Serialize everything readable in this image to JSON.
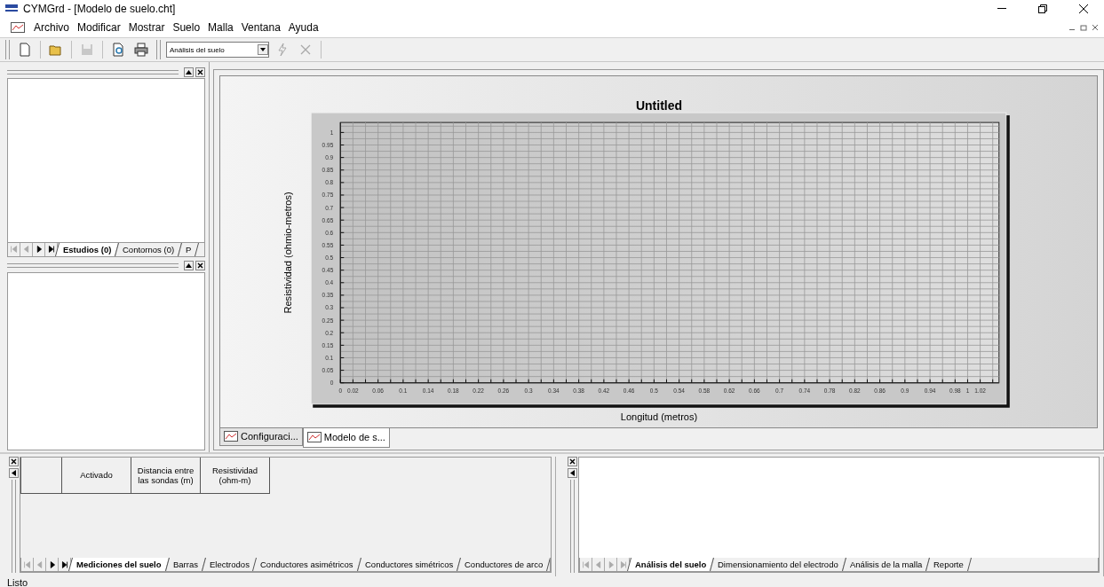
{
  "window": {
    "title": "CYMGrd - [Modelo de suelo.cht]"
  },
  "menu": [
    "Archivo",
    "Modificar",
    "Mostrar",
    "Suelo",
    "Malla",
    "Ventana",
    "Ayuda"
  ],
  "toolbar": {
    "buttons": [
      {
        "kind": "new",
        "disabled": false
      },
      {
        "kind": "open",
        "disabled": false
      },
      {
        "kind": "save",
        "disabled": true
      },
      {
        "kind": "preview",
        "disabled": false
      },
      {
        "kind": "print",
        "disabled": false
      }
    ],
    "study_select": {
      "value": "Análisis del suelo"
    },
    "actions": [
      {
        "kind": "run",
        "disabled": true
      },
      {
        "kind": "stop",
        "disabled": true
      }
    ]
  },
  "left_top_panel": {
    "nav_enabled": true,
    "tabs": [
      {
        "label": "Estudios (0)",
        "selected": true
      },
      {
        "label": "Contornos (0)",
        "selected": false
      },
      {
        "label": "P",
        "selected": false
      }
    ]
  },
  "chart_window": {
    "chart_data": {
      "type": "line",
      "grid": true,
      "title": "Untitled",
      "xlabel": "Longitud (metros)",
      "ylabel": "Resistividad (ohmio-metros)",
      "xlim": [
        0,
        1.05
      ],
      "ylim": [
        0,
        1.04
      ],
      "xticks": [
        0,
        0.02,
        0.06,
        0.1,
        0.14,
        0.18,
        0.22,
        0.26,
        0.3,
        0.34,
        0.38,
        0.42,
        0.46,
        0.5,
        0.54,
        0.58,
        0.62,
        0.66,
        0.7,
        0.74,
        0.78,
        0.82,
        0.86,
        0.9,
        0.94,
        0.98,
        1,
        1.02
      ],
      "yticks": [
        0,
        0.05,
        0.1,
        0.15,
        0.2,
        0.25,
        0.3,
        0.35,
        0.4,
        0.45,
        0.5,
        0.55,
        0.6,
        0.65,
        0.7,
        0.75,
        0.8,
        0.85,
        0.9,
        0.95,
        1
      ]
    },
    "tabs": [
      {
        "label": "Configuraci...",
        "selected": false
      },
      {
        "label": "Modelo de s...",
        "selected": true
      }
    ]
  },
  "measurements_panel": {
    "columns": [
      "",
      "Activado",
      "Distancia entre las sondas (m)",
      "Resistividad (ohm-m)"
    ],
    "nav_enabled": true,
    "tabs": [
      {
        "label": "Mediciones del suelo",
        "selected": true
      },
      {
        "label": "Barras",
        "selected": false
      },
      {
        "label": "Electrodos",
        "selected": false
      },
      {
        "label": "Conductores asimétricos",
        "selected": false
      },
      {
        "label": "Conductores simétricos",
        "selected": false
      },
      {
        "label": "Conductores de arco",
        "selected": false
      }
    ]
  },
  "results_panel": {
    "nav_enabled": false,
    "tabs": [
      {
        "label": "Análisis del suelo",
        "selected": true
      },
      {
        "label": "Dimensionamiento del electrodo",
        "selected": false
      },
      {
        "label": "Análisis de la malla",
        "selected": false
      },
      {
        "label": "Reporte",
        "selected": false
      }
    ]
  },
  "status_bar": {
    "text": "Listo"
  }
}
